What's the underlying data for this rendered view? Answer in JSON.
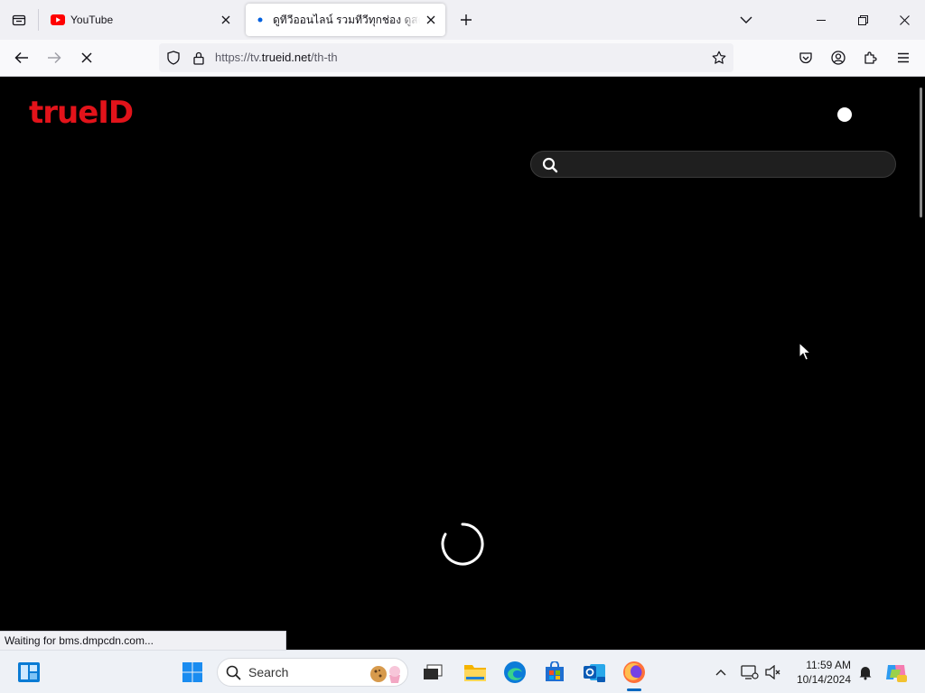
{
  "browser": {
    "tabs": [
      {
        "title": "YouTube",
        "active": false,
        "favicon": "youtube-icon"
      },
      {
        "title": "ดูทีวีออนไลน์ รวมทีวีทุกช่อง ดูสดฟรี",
        "active": true,
        "favicon": "loading-dot-icon"
      }
    ],
    "url": {
      "prefix": "https://tv.",
      "host": "trueid.net",
      "path": "/th-th"
    },
    "status": "Waiting for bms.dmpcdn.com..."
  },
  "page": {
    "logo": "trueID",
    "search": {
      "placeholder": "",
      "value": ""
    },
    "loading": true
  },
  "taskbar": {
    "search_label": "Search",
    "time": "11:59 AM",
    "date": "10/14/2024",
    "pinned": [
      "widgets-icon",
      "start-icon",
      "task-view-icon",
      "file-explorer-icon",
      "edge-icon",
      "store-icon",
      "outlook-icon",
      "firefox-icon"
    ]
  },
  "colors": {
    "brand_red": "#e2131a",
    "page_bg": "#000000",
    "accent_blue": "#0067c0"
  }
}
